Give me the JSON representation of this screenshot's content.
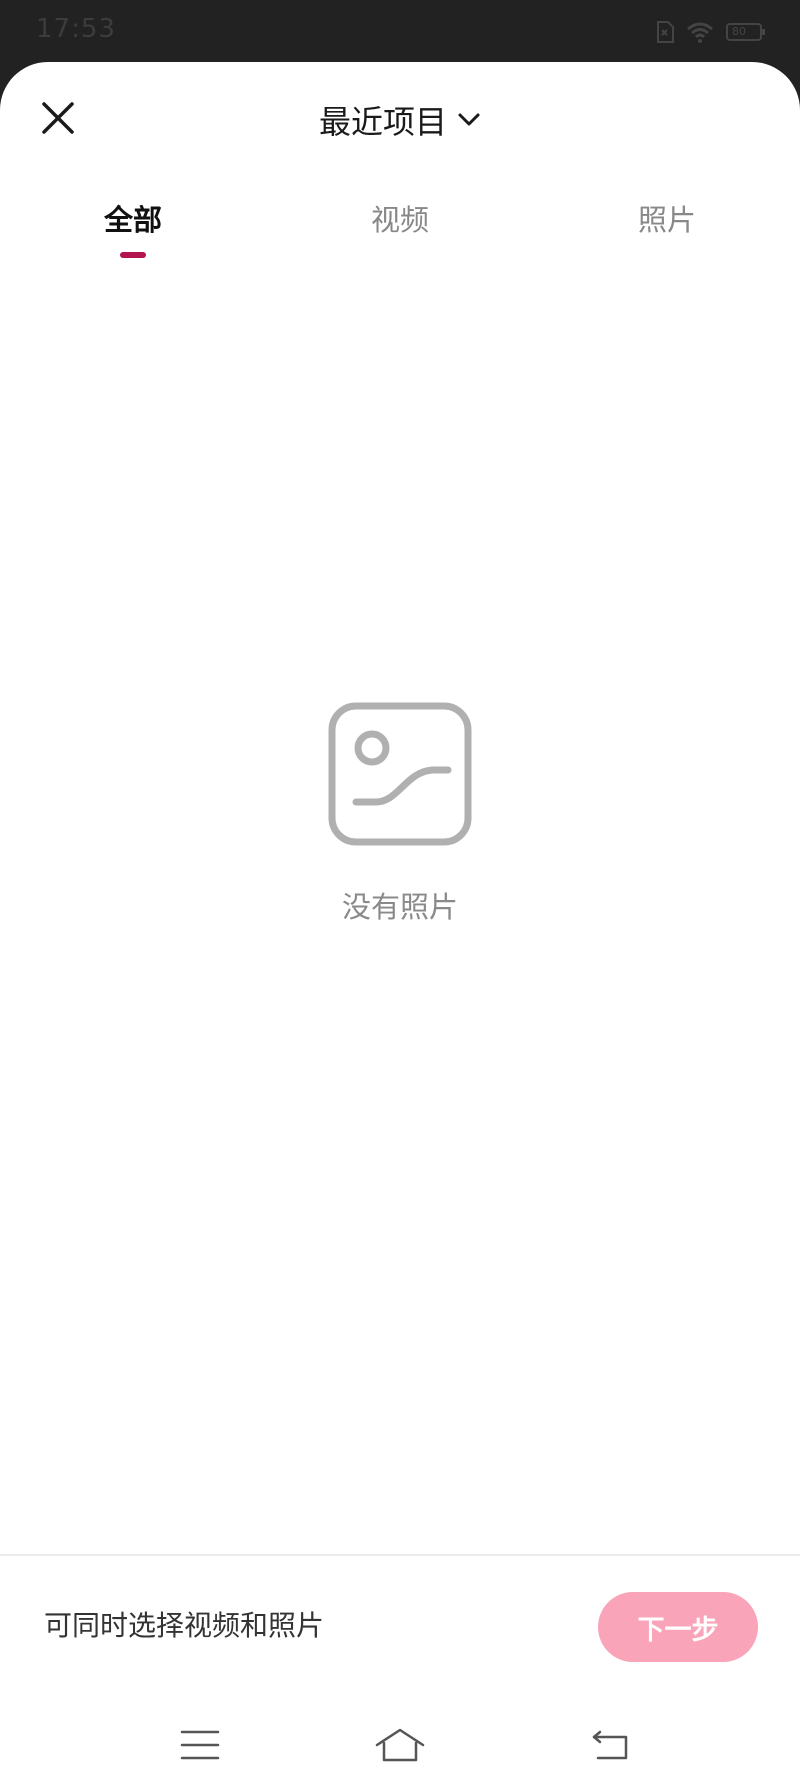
{
  "status_bar": {
    "time": "17:53",
    "battery_text": "80",
    "icons": [
      "sim-icon",
      "wifi-icon",
      "battery-icon"
    ]
  },
  "header": {
    "close_icon": "close-icon",
    "album_title": "最近项目",
    "dropdown_icon": "chevron-down-icon"
  },
  "tabs": [
    {
      "label": "全部",
      "active": true
    },
    {
      "label": "视频",
      "active": false
    },
    {
      "label": "照片",
      "active": false
    }
  ],
  "empty_state": {
    "icon": "image-placeholder-icon",
    "message": "没有照片"
  },
  "footer": {
    "hint": "可同时选择视频和照片",
    "next_label": "下一步"
  },
  "nav_bar": {
    "icons": [
      "menu-icon",
      "home-icon",
      "back-icon"
    ]
  },
  "colors": {
    "accent": "#b3134f",
    "next_button": "#f9a4b9",
    "status_bar_bg": "#222222"
  }
}
